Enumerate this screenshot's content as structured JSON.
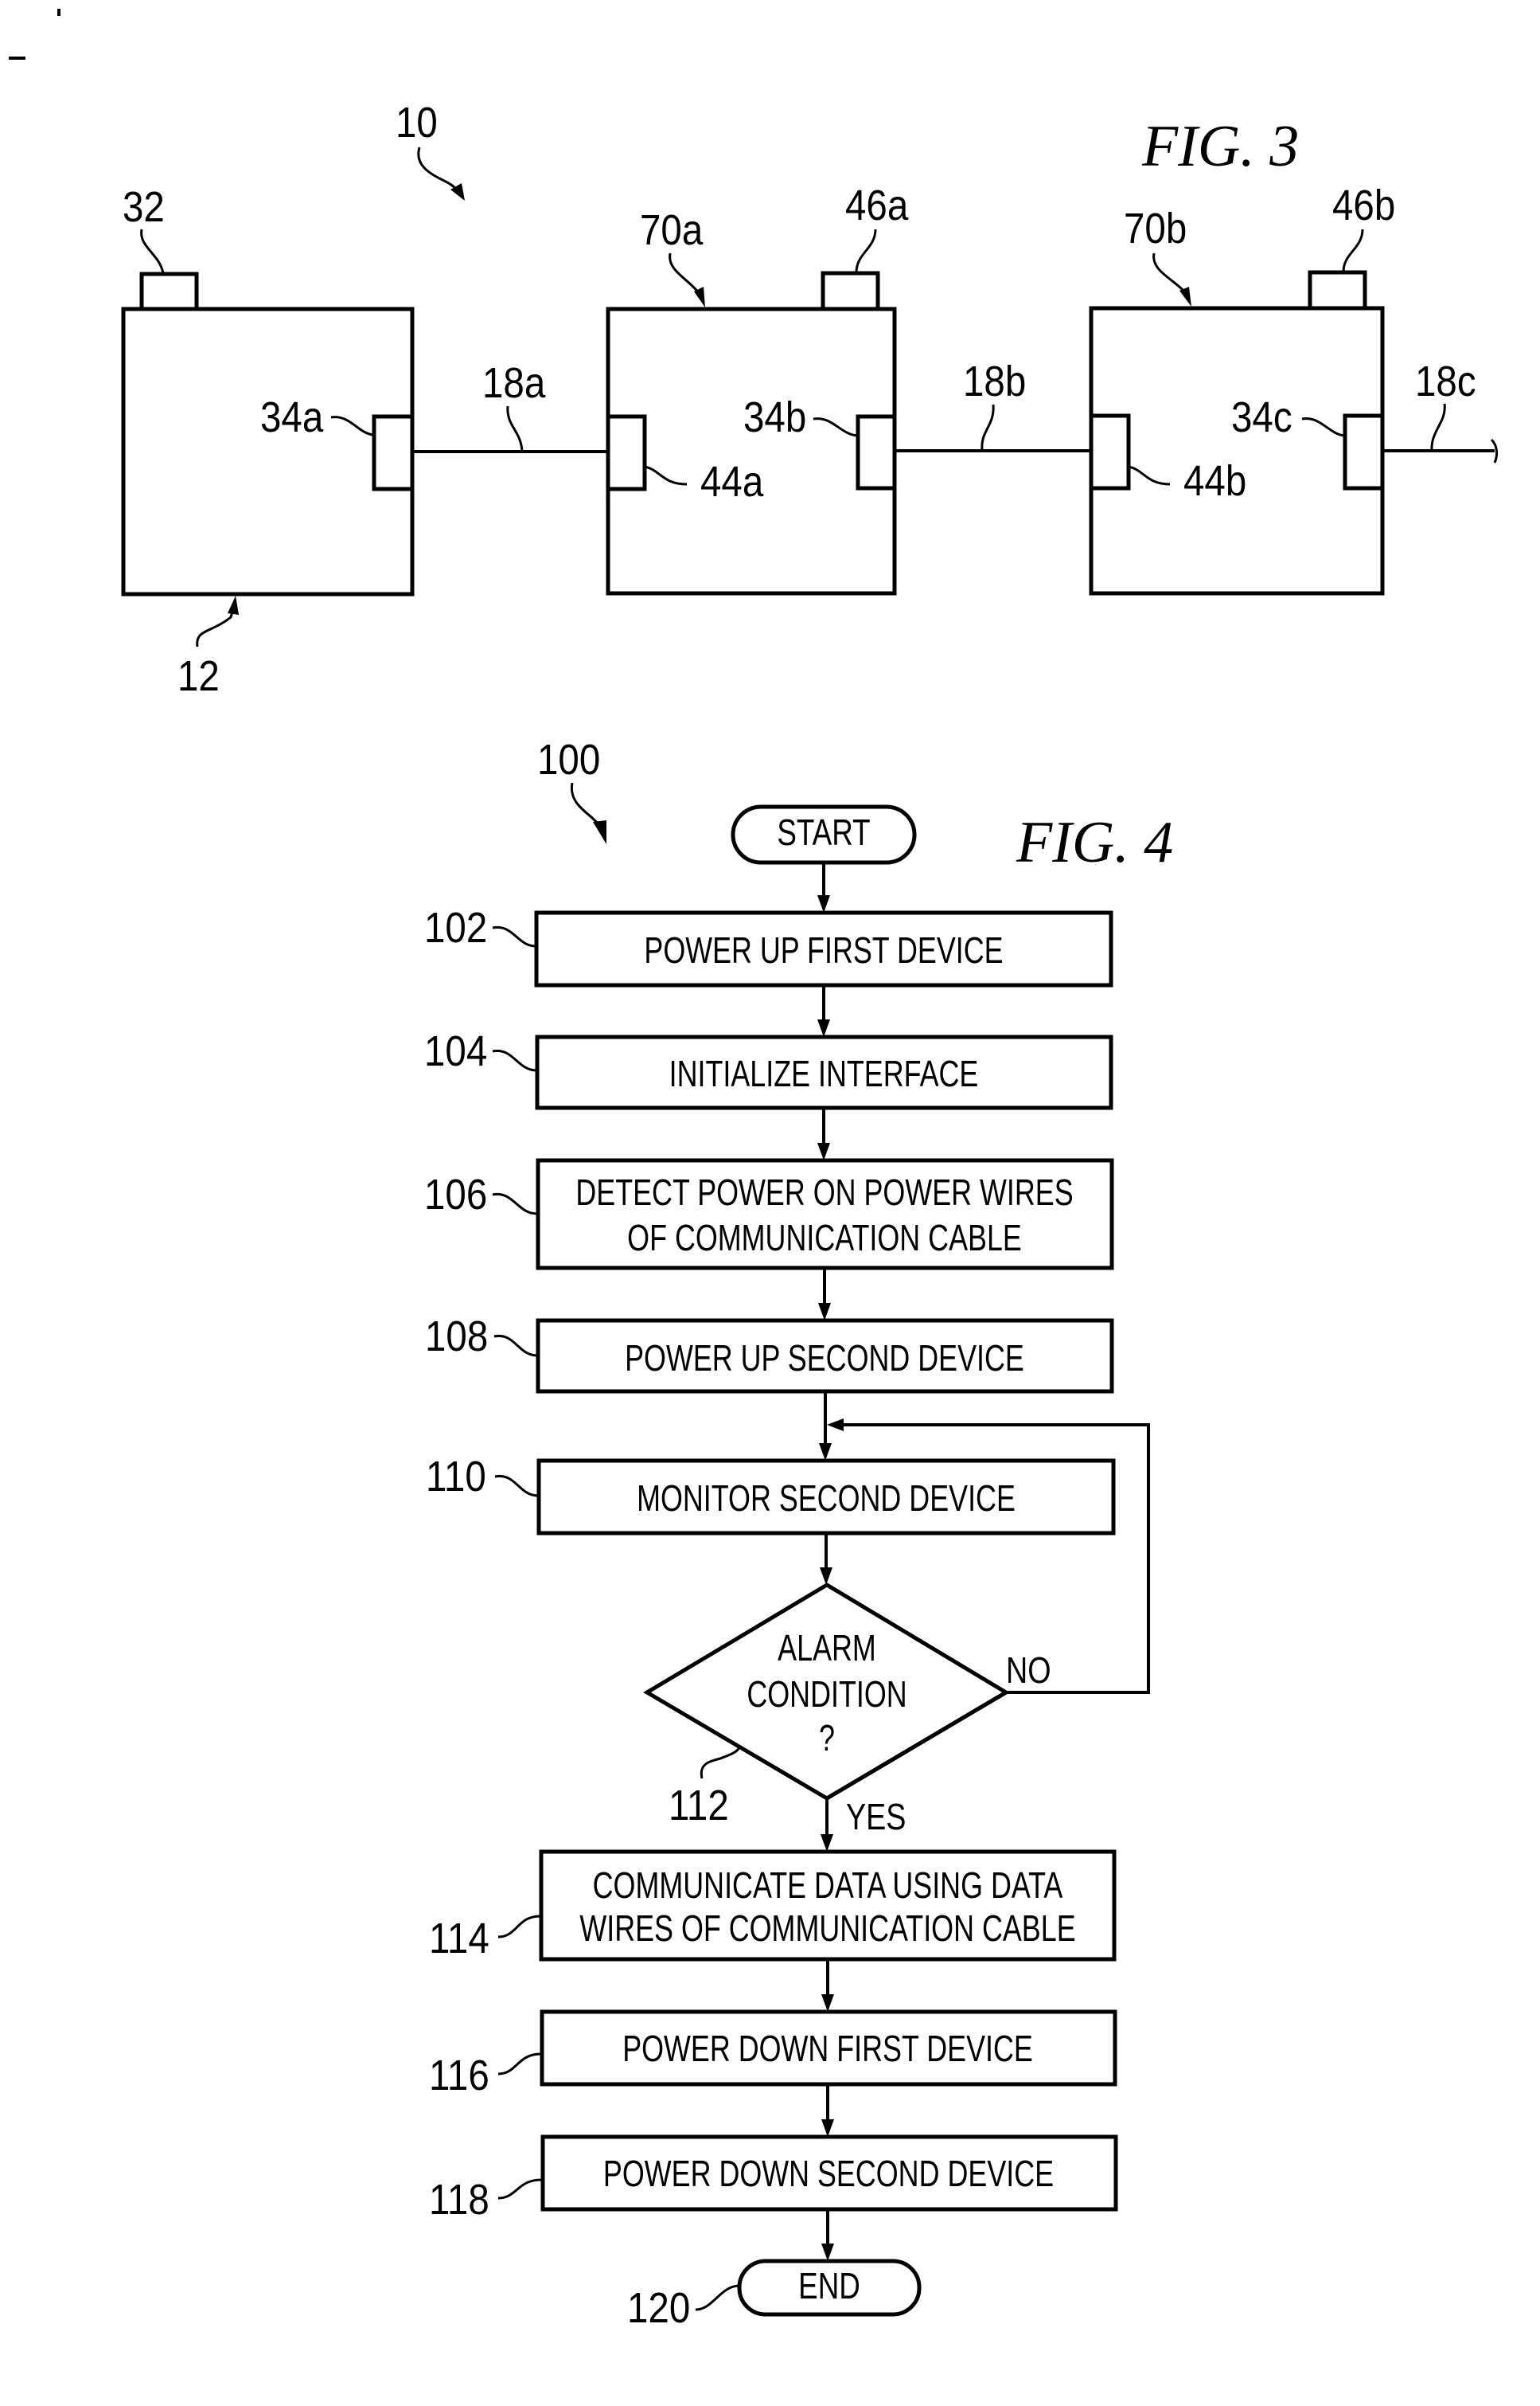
{
  "figure3": {
    "title": "FIG. 3",
    "system_ref": "10",
    "first_device": {
      "ref": "12",
      "tab_ref": "32",
      "port_ref": "34a"
    },
    "second_device_a": {
      "ref": "70a",
      "tab_ref": "46a",
      "in_port_ref": "44a",
      "out_port_ref": "34b"
    },
    "second_device_b": {
      "ref": "70b",
      "tab_ref": "46b",
      "in_port_ref": "44b",
      "out_port_ref": "34c"
    },
    "cables": [
      "18a",
      "18b",
      "18c"
    ]
  },
  "figure4": {
    "title": "FIG. 4",
    "method_ref": "100",
    "start": {
      "label": "START"
    },
    "steps": [
      {
        "ref": "102",
        "lines": [
          "POWER UP FIRST DEVICE"
        ]
      },
      {
        "ref": "104",
        "lines": [
          "INITIALIZE INTERFACE"
        ]
      },
      {
        "ref": "106",
        "lines": [
          "DETECT POWER ON POWER WIRES",
          "OF COMMUNICATION CABLE"
        ]
      },
      {
        "ref": "108",
        "lines": [
          "POWER UP SECOND DEVICE"
        ]
      },
      {
        "ref": "110",
        "lines": [
          "MONITOR SECOND DEVICE"
        ]
      }
    ],
    "decision": {
      "ref": "112",
      "lines": [
        "ALARM",
        "CONDITION",
        "?"
      ],
      "no_label": "NO",
      "yes_label": "YES"
    },
    "after_steps": [
      {
        "ref": "114",
        "lines": [
          "COMMUNICATE DATA USING DATA",
          "WIRES OF COMMUNICATION CABLE"
        ]
      },
      {
        "ref": "116",
        "lines": [
          "POWER DOWN FIRST DEVICE"
        ]
      },
      {
        "ref": "118",
        "lines": [
          "POWER DOWN SECOND DEVICE"
        ]
      }
    ],
    "end": {
      "ref": "120",
      "label": "END"
    }
  }
}
